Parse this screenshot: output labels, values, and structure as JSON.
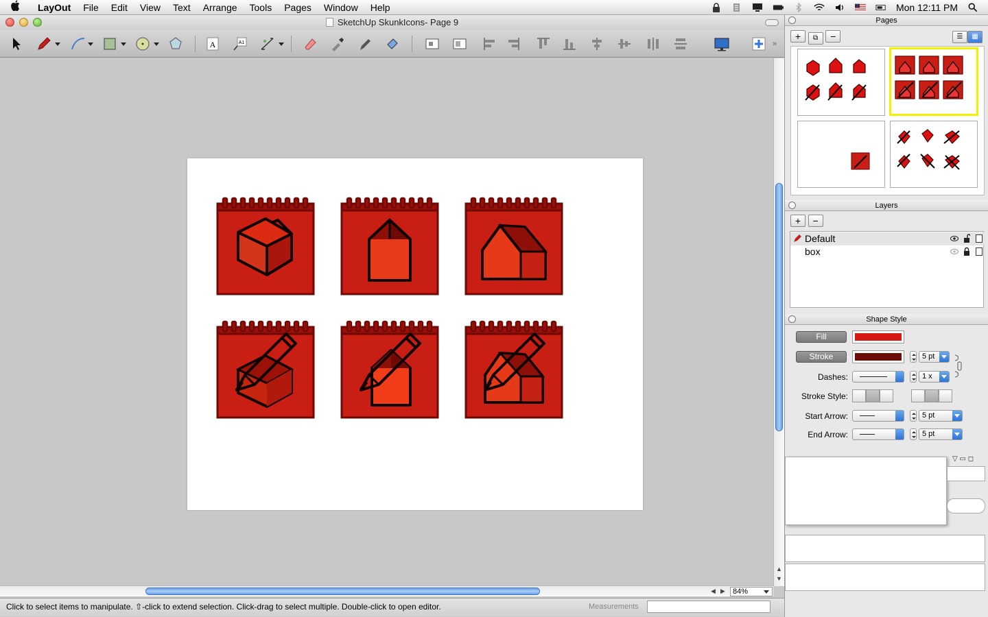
{
  "menubar": {
    "app_name": "LayOut",
    "items": [
      "File",
      "Edit",
      "View",
      "Text",
      "Arrange",
      "Tools",
      "Pages",
      "Window",
      "Help"
    ],
    "clock": "Mon 12:11 PM"
  },
  "window": {
    "title": "SketchUp SkunkIcons- Page 9"
  },
  "canvas": {
    "zoom": "84%",
    "icon_fill": "#c81e14",
    "icon_dark": "#6e0a06"
  },
  "status": {
    "hint": "Click to select items to manipulate. ⇧-click to extend selection. Click-drag to select multiple. Double-click to open editor.",
    "measurements_label": "Measurements"
  },
  "pages_panel": {
    "title": "Pages"
  },
  "layers_panel": {
    "title": "Layers",
    "layers": [
      {
        "name": "Default",
        "active": true
      },
      {
        "name": "box",
        "active": false
      }
    ]
  },
  "shape_style": {
    "title": "Shape Style",
    "fill_label": "Fill",
    "stroke_label": "Stroke",
    "fill_color": "#d51a16",
    "stroke_color": "#6b0c08",
    "stroke_width": "5 pt",
    "dashes_label": "Dashes:",
    "dash_scale": "1 x",
    "stroke_style_label": "Stroke Style:",
    "start_arrow_label": "Start Arrow:",
    "start_arrow_size": "5 pt",
    "end_arrow_label": "End Arrow:",
    "end_arrow_size": "5 pt"
  }
}
